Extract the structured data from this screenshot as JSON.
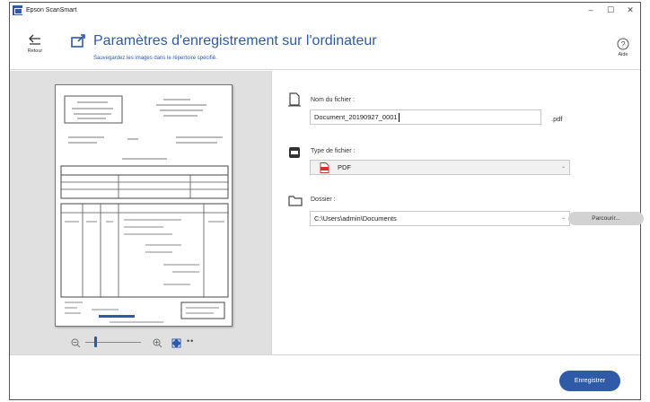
{
  "window": {
    "title": "Epson ScanSmart",
    "controls": [
      "–",
      "☐",
      "✕"
    ]
  },
  "header": {
    "back_label": "Retour",
    "title": "Paramètres d'enregistrement sur l'ordinateur",
    "subtitle": "Sauvegardez les images dans le répertoire spécifié.",
    "help_label": "Aide"
  },
  "form": {
    "file_name": {
      "label": "Nom du fichier :",
      "value": "Document_20190927_0001",
      "extension": ".pdf"
    },
    "file_type": {
      "label": "Type de fichier :",
      "value": "PDF"
    },
    "folder": {
      "label": "Dossier :",
      "value": "C:\\Users\\admin\\Documents",
      "browse_label": "Parcourir..."
    }
  },
  "preview": {
    "zoom_level": 0.16,
    "more_label": "••"
  },
  "footer": {
    "save_label": "Enregistrer"
  },
  "colors": {
    "accent": "#2f5aa8",
    "preview_bg": "#e0e0e0",
    "pdf_red": "#d2322d"
  },
  "icons": [
    "app-logo",
    "back-arrow-icon",
    "save-to-computer-icon",
    "help-icon",
    "file-icon",
    "file-type-icon",
    "folder-icon",
    "pdf-icon",
    "zoom-out-icon",
    "zoom-in-icon",
    "fit-page-icon"
  ]
}
